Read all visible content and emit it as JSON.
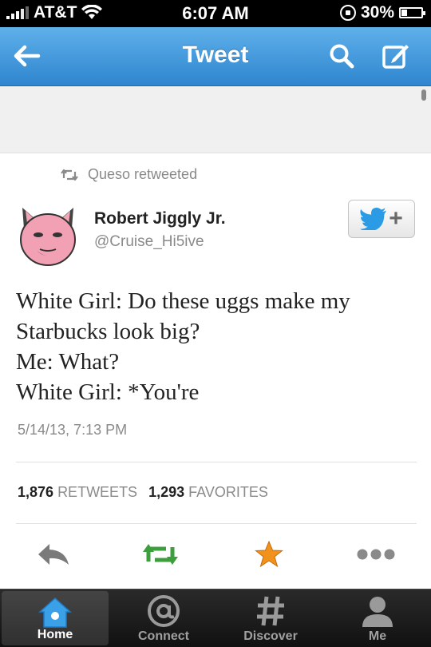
{
  "status_bar": {
    "carrier": "AT&T",
    "time": "6:07 AM",
    "battery": "30%",
    "battery_level": 0.3
  },
  "nav": {
    "title": "Tweet",
    "back_icon": "back-arrow-icon",
    "search_icon": "search-icon",
    "compose_icon": "compose-icon"
  },
  "tweet": {
    "retweeted_by": "Queso retweeted",
    "author_name": "Robert Jiggly Jr.",
    "author_handle": "@Cruise_Hi5ive",
    "follow_plus": "+",
    "text_lines": [
      "White Girl: Do these uggs make my",
      "Starbucks look big?",
      "Me: What?",
      "White Girl: *You're"
    ],
    "date": "5/14/13, 7:13 PM",
    "retweets_count": "1,876",
    "retweets_label": "RETWEETS",
    "favorites_count": "1,293",
    "favorites_label": "FAVORITES"
  },
  "actions": [
    "reply-icon",
    "retweet-icon",
    "favorite-star-icon",
    "more-icon"
  ],
  "tabs": [
    {
      "label": "Home",
      "icon": "home-icon",
      "active": true
    },
    {
      "label": "Connect",
      "icon": "at-sign-icon",
      "active": false
    },
    {
      "label": "Discover",
      "icon": "hashtag-icon",
      "active": false
    },
    {
      "label": "Me",
      "icon": "person-icon",
      "active": false
    }
  ],
  "colors": {
    "nav_blue": "#3b8fd6",
    "twitter_blue": "#2a9be4",
    "retweet_green": "#3d9e3d",
    "star_orange": "#f0921c",
    "tab_home_blue": "#3aa0e8"
  }
}
